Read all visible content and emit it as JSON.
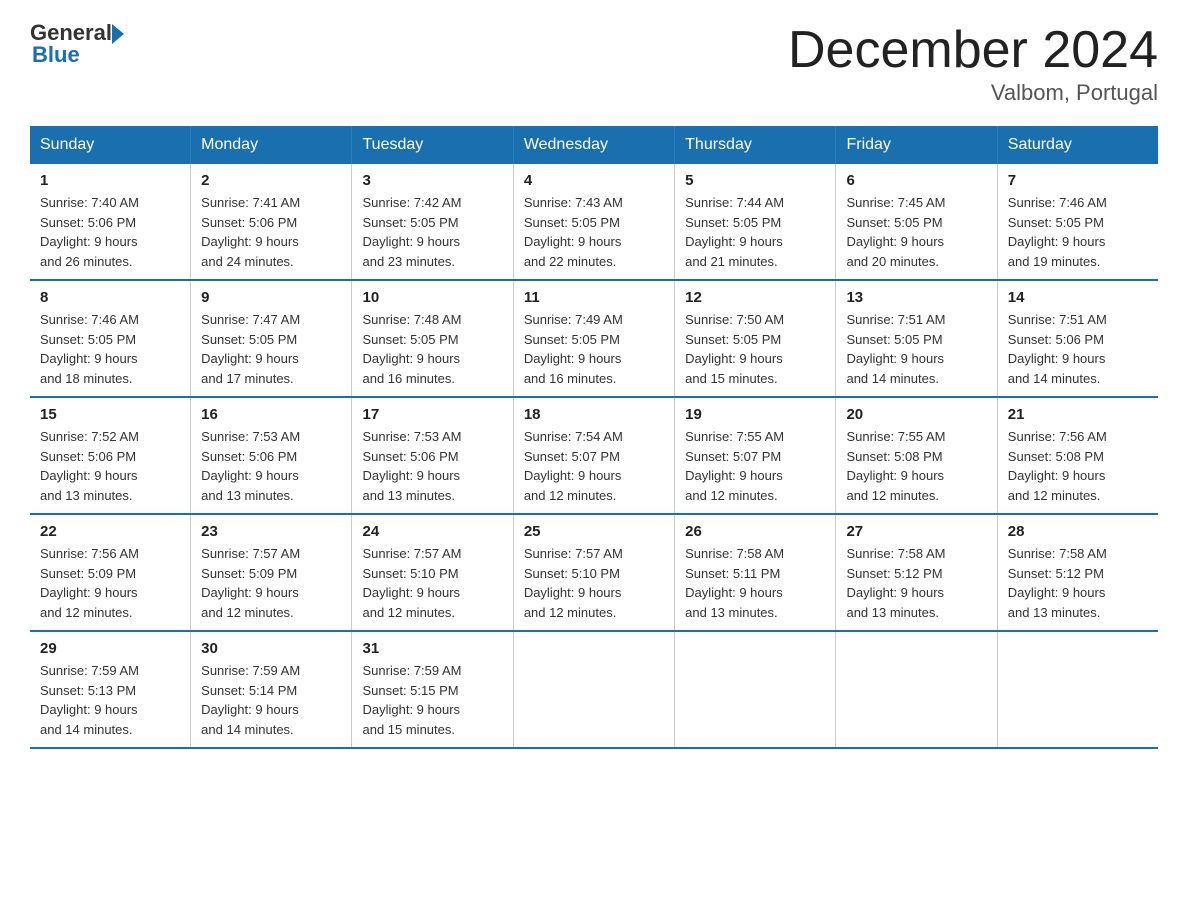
{
  "header": {
    "title": "December 2024",
    "subtitle": "Valbom, Portugal",
    "logo_general": "General",
    "logo_blue": "Blue"
  },
  "days_of_week": [
    "Sunday",
    "Monday",
    "Tuesday",
    "Wednesday",
    "Thursday",
    "Friday",
    "Saturday"
  ],
  "weeks": [
    [
      {
        "day": "1",
        "sunrise": "7:40 AM",
        "sunset": "5:06 PM",
        "daylight": "9 hours and 26 minutes."
      },
      {
        "day": "2",
        "sunrise": "7:41 AM",
        "sunset": "5:06 PM",
        "daylight": "9 hours and 24 minutes."
      },
      {
        "day": "3",
        "sunrise": "7:42 AM",
        "sunset": "5:05 PM",
        "daylight": "9 hours and 23 minutes."
      },
      {
        "day": "4",
        "sunrise": "7:43 AM",
        "sunset": "5:05 PM",
        "daylight": "9 hours and 22 minutes."
      },
      {
        "day": "5",
        "sunrise": "7:44 AM",
        "sunset": "5:05 PM",
        "daylight": "9 hours and 21 minutes."
      },
      {
        "day": "6",
        "sunrise": "7:45 AM",
        "sunset": "5:05 PM",
        "daylight": "9 hours and 20 minutes."
      },
      {
        "day": "7",
        "sunrise": "7:46 AM",
        "sunset": "5:05 PM",
        "daylight": "9 hours and 19 minutes."
      }
    ],
    [
      {
        "day": "8",
        "sunrise": "7:46 AM",
        "sunset": "5:05 PM",
        "daylight": "9 hours and 18 minutes."
      },
      {
        "day": "9",
        "sunrise": "7:47 AM",
        "sunset": "5:05 PM",
        "daylight": "9 hours and 17 minutes."
      },
      {
        "day": "10",
        "sunrise": "7:48 AM",
        "sunset": "5:05 PM",
        "daylight": "9 hours and 16 minutes."
      },
      {
        "day": "11",
        "sunrise": "7:49 AM",
        "sunset": "5:05 PM",
        "daylight": "9 hours and 16 minutes."
      },
      {
        "day": "12",
        "sunrise": "7:50 AM",
        "sunset": "5:05 PM",
        "daylight": "9 hours and 15 minutes."
      },
      {
        "day": "13",
        "sunrise": "7:51 AM",
        "sunset": "5:05 PM",
        "daylight": "9 hours and 14 minutes."
      },
      {
        "day": "14",
        "sunrise": "7:51 AM",
        "sunset": "5:06 PM",
        "daylight": "9 hours and 14 minutes."
      }
    ],
    [
      {
        "day": "15",
        "sunrise": "7:52 AM",
        "sunset": "5:06 PM",
        "daylight": "9 hours and 13 minutes."
      },
      {
        "day": "16",
        "sunrise": "7:53 AM",
        "sunset": "5:06 PM",
        "daylight": "9 hours and 13 minutes."
      },
      {
        "day": "17",
        "sunrise": "7:53 AM",
        "sunset": "5:06 PM",
        "daylight": "9 hours and 13 minutes."
      },
      {
        "day": "18",
        "sunrise": "7:54 AM",
        "sunset": "5:07 PM",
        "daylight": "9 hours and 12 minutes."
      },
      {
        "day": "19",
        "sunrise": "7:55 AM",
        "sunset": "5:07 PM",
        "daylight": "9 hours and 12 minutes."
      },
      {
        "day": "20",
        "sunrise": "7:55 AM",
        "sunset": "5:08 PM",
        "daylight": "9 hours and 12 minutes."
      },
      {
        "day": "21",
        "sunrise": "7:56 AM",
        "sunset": "5:08 PM",
        "daylight": "9 hours and 12 minutes."
      }
    ],
    [
      {
        "day": "22",
        "sunrise": "7:56 AM",
        "sunset": "5:09 PM",
        "daylight": "9 hours and 12 minutes."
      },
      {
        "day": "23",
        "sunrise": "7:57 AM",
        "sunset": "5:09 PM",
        "daylight": "9 hours and 12 minutes."
      },
      {
        "day": "24",
        "sunrise": "7:57 AM",
        "sunset": "5:10 PM",
        "daylight": "9 hours and 12 minutes."
      },
      {
        "day": "25",
        "sunrise": "7:57 AM",
        "sunset": "5:10 PM",
        "daylight": "9 hours and 12 minutes."
      },
      {
        "day": "26",
        "sunrise": "7:58 AM",
        "sunset": "5:11 PM",
        "daylight": "9 hours and 13 minutes."
      },
      {
        "day": "27",
        "sunrise": "7:58 AM",
        "sunset": "5:12 PM",
        "daylight": "9 hours and 13 minutes."
      },
      {
        "day": "28",
        "sunrise": "7:58 AM",
        "sunset": "5:12 PM",
        "daylight": "9 hours and 13 minutes."
      }
    ],
    [
      {
        "day": "29",
        "sunrise": "7:59 AM",
        "sunset": "5:13 PM",
        "daylight": "9 hours and 14 minutes."
      },
      {
        "day": "30",
        "sunrise": "7:59 AM",
        "sunset": "5:14 PM",
        "daylight": "9 hours and 14 minutes."
      },
      {
        "day": "31",
        "sunrise": "7:59 AM",
        "sunset": "5:15 PM",
        "daylight": "9 hours and 15 minutes."
      },
      {
        "day": "",
        "sunrise": "",
        "sunset": "",
        "daylight": ""
      },
      {
        "day": "",
        "sunrise": "",
        "sunset": "",
        "daylight": ""
      },
      {
        "day": "",
        "sunrise": "",
        "sunset": "",
        "daylight": ""
      },
      {
        "day": "",
        "sunrise": "",
        "sunset": "",
        "daylight": ""
      }
    ]
  ],
  "labels": {
    "sunrise_prefix": "Sunrise: ",
    "sunset_prefix": "Sunset: ",
    "daylight_prefix": "Daylight: "
  }
}
